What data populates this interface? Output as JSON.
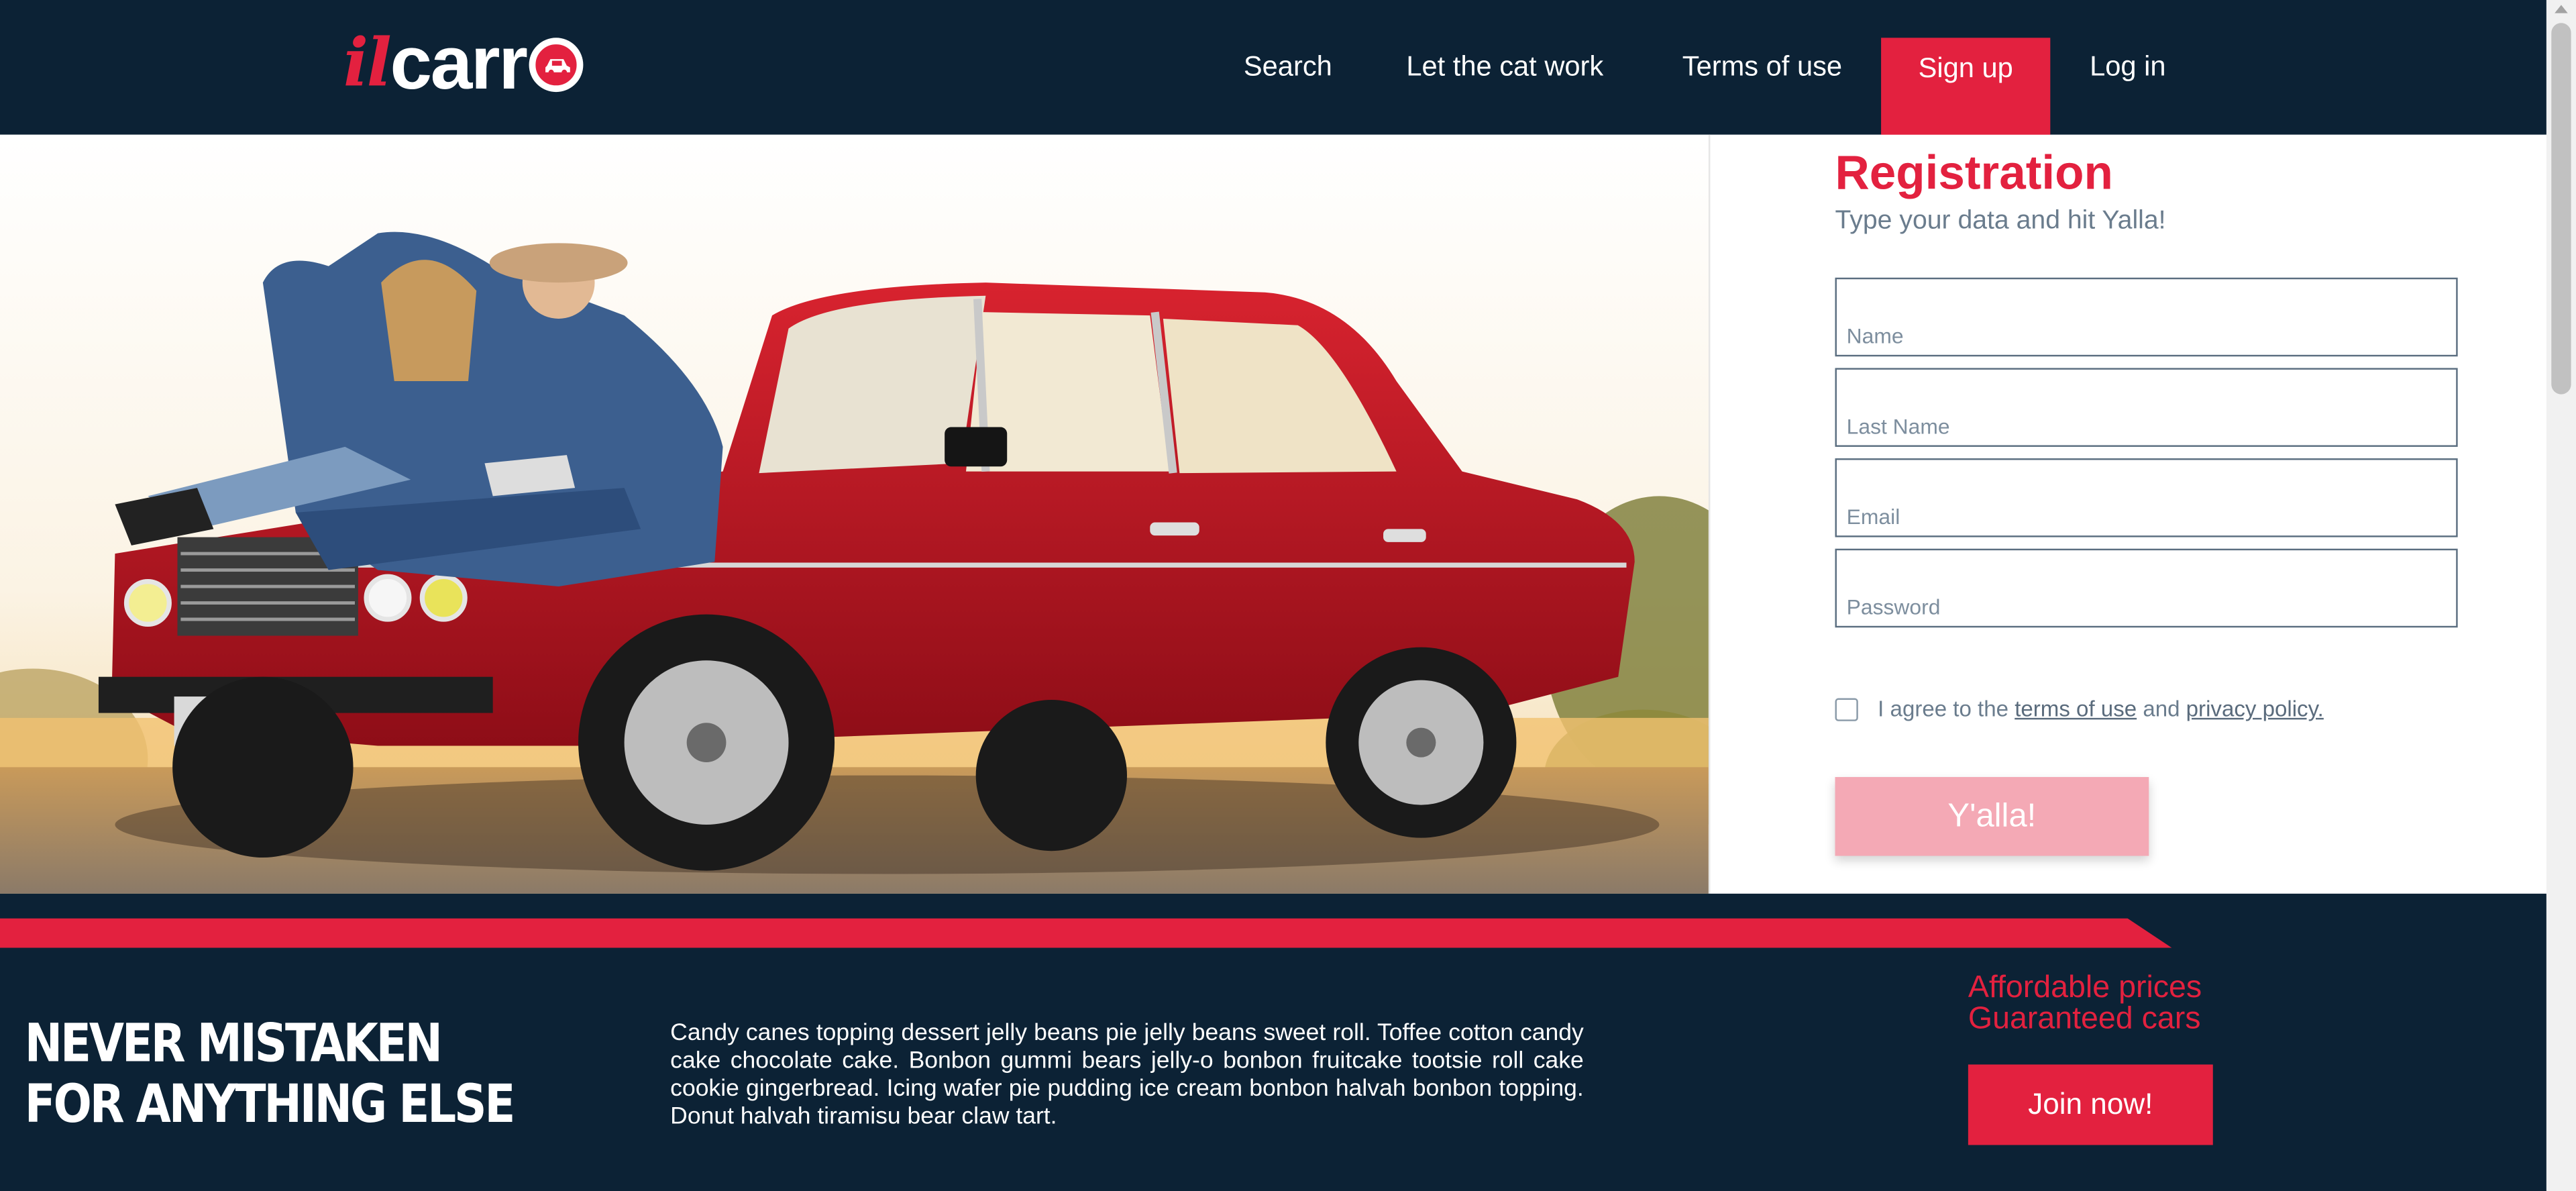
{
  "brand": {
    "logo_prefix": "il",
    "logo_main": "carr"
  },
  "nav": {
    "search": "Search",
    "cat": "Let the cat work",
    "terms": "Terms of use",
    "signup": "Sign up",
    "login": "Log in"
  },
  "registration": {
    "title": "Registration",
    "subtitle": "Type your data and hit Yalla!",
    "name_placeholder": "Name",
    "lastname_placeholder": "Last Name",
    "email_placeholder": "Email",
    "password_placeholder": "Password",
    "agree_prefix": "I agree to the ",
    "terms_link": "terms of use",
    "agree_mid": " and ",
    "privacy_link": "privacy policy.",
    "submit": "Y'alla!"
  },
  "footer": {
    "tagline_line1": "NEVER MISTAKEN",
    "tagline_line2": "FOR ANYTHING ELSE",
    "body": "Candy canes topping dessert jelly beans pie jelly beans sweet roll. Toffee cotton candy cake chocolate cake. Bonbon gummi bears jelly-o bonbon fruitcake tootsie roll cake cookie gingerbread. Icing wafer pie pudding ice cream bonbon halvah bonbon topping. Donut halvah tiramisu bear claw tart.",
    "promo_line1": "Affordable prices",
    "promo_line2": "Guaranteed cars",
    "join": "Join now!"
  },
  "colors": {
    "navy": "#0c2235",
    "accent": "#e3213f",
    "button_disabled": "#f4a9b5"
  },
  "icons": {
    "logo_badge": "car-icon"
  }
}
